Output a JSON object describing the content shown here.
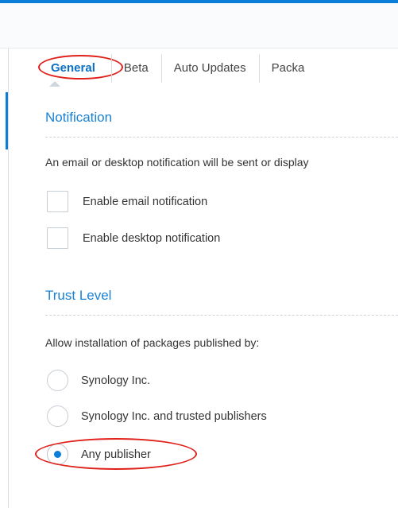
{
  "tabs": [
    {
      "label": "General",
      "active": true
    },
    {
      "label": "Beta",
      "active": false
    },
    {
      "label": "Auto Updates",
      "active": false
    },
    {
      "label": "Packa",
      "active": false
    }
  ],
  "notification": {
    "title": "Notification",
    "description": "An email or desktop notification will be sent or display",
    "options": [
      {
        "label": "Enable email notification",
        "checked": false
      },
      {
        "label": "Enable desktop notification",
        "checked": false
      }
    ]
  },
  "trust_level": {
    "title": "Trust Level",
    "description": "Allow installation of packages published by:",
    "options": [
      {
        "label": "Synology Inc.",
        "selected": false
      },
      {
        "label": "Synology Inc. and trusted publishers",
        "selected": false
      },
      {
        "label": "Any publisher",
        "selected": true
      }
    ]
  },
  "colors": {
    "accent": "#0b7dda",
    "annotation": "#e0201a"
  }
}
